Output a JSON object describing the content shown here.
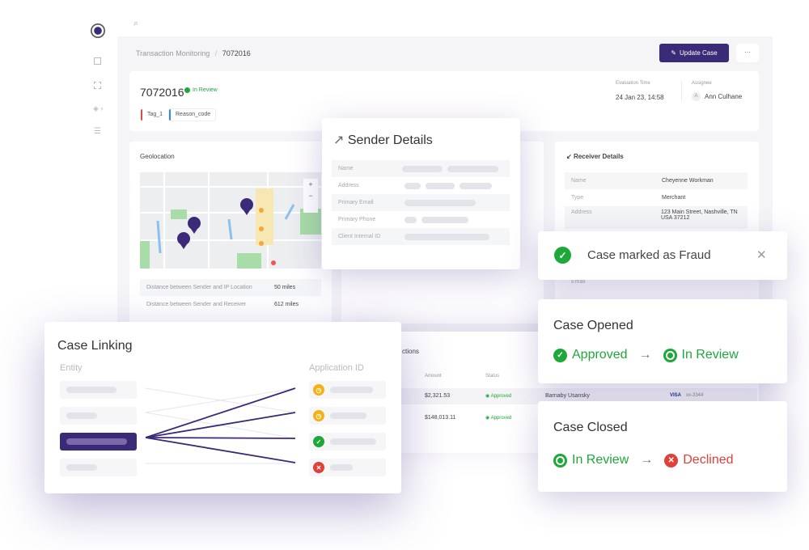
{
  "sidebar": {
    "icons": [
      "logo-icon",
      "dashboard-icon",
      "transactions-icon",
      "layers-icon",
      "list-icon"
    ]
  },
  "breadcrumb": {
    "parent": "Transaction Monitoring",
    "separator": "/",
    "current": "7072016"
  },
  "header": {
    "update_label": "Update Case",
    "more_label": "···"
  },
  "case": {
    "id": "7072016",
    "status": "In Review",
    "tags": [
      {
        "label": "Tag_1",
        "color": "#e04848"
      },
      {
        "label": "Reason_code",
        "color": "#2f8be6"
      }
    ],
    "eval_label": "Evaluation Time",
    "eval_value": "24 Jan 23, 14:58",
    "assignee_label": "Assignee",
    "assignee_initial": "A",
    "assignee": "Ann Culhane"
  },
  "geolocation": {
    "title": "Geolocation",
    "zoom_in": "+",
    "zoom_out": "−",
    "rows": [
      {
        "label": "Distance between Sender and IP Location",
        "value": "50 miles"
      },
      {
        "label": "Distance between Sender and Receiver",
        "value": "612 miles"
      }
    ]
  },
  "receiver": {
    "title": "Receiver Details",
    "rows": [
      {
        "label": "Name",
        "value": "Cheyenne Workman"
      },
      {
        "label": "Type",
        "value": "Merchant"
      },
      {
        "label": "Address",
        "value": "123 Main Street, Nashville, TN USA 37212"
      }
    ],
    "extra_label": "Email"
  },
  "sender": {
    "title": "Sender Details",
    "rows": [
      "Name",
      "Address",
      "Primary Email",
      "Primary Phone",
      "Client Internal ID"
    ]
  },
  "transactions": {
    "title": "ctions",
    "headers": [
      "Amount",
      "Status"
    ],
    "rows": [
      {
        "amount": "$2,321.53",
        "status": "Approved",
        "name": "Barnaby Usansky",
        "card_brand": "VISA",
        "card": "xx-3344"
      },
      {
        "amount": "$148,013.11",
        "status": "Approved"
      }
    ]
  },
  "toast": {
    "message": "Case marked as Fraud",
    "close": "✕"
  },
  "case_opened": {
    "title": "Case Opened",
    "from": "Approved",
    "to": "In Review"
  },
  "case_closed": {
    "title": "Case Closed",
    "from": "In Review",
    "to": "Declined"
  },
  "case_linking": {
    "title": "Case Linking",
    "entity_label": "Entity",
    "app_label": "Application ID",
    "apps": [
      "pending",
      "pending",
      "approved",
      "declined"
    ]
  },
  "colors": {
    "brand": "#3b2a78",
    "green": "#1fa83a",
    "red": "#e0403a",
    "amber": "#f5b014"
  }
}
